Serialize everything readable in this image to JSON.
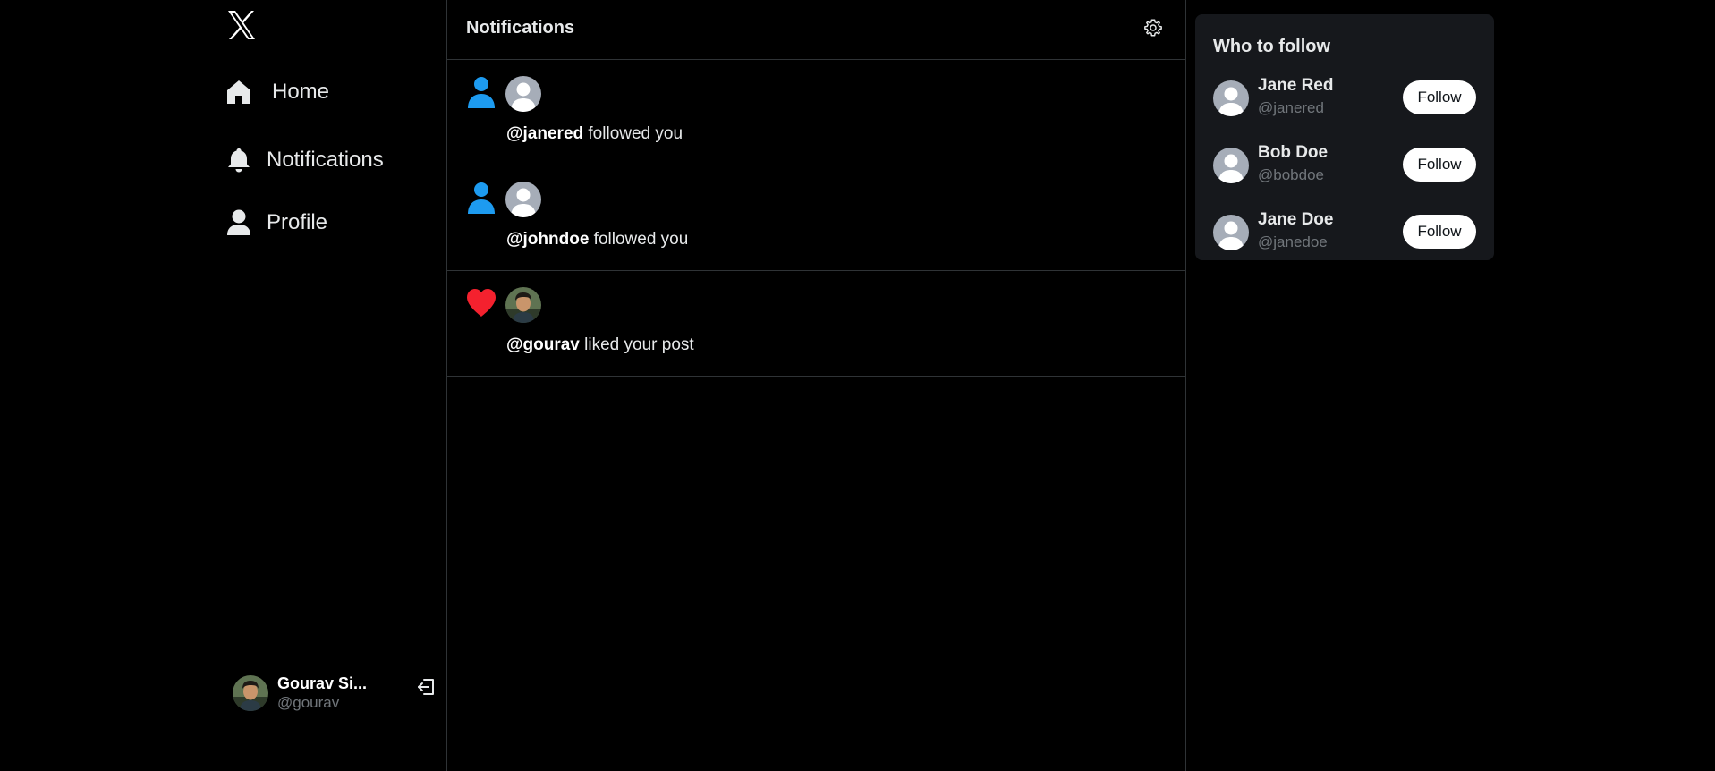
{
  "app": {
    "logo_icon": "x-logo-icon"
  },
  "sidebar": {
    "nav": [
      {
        "label": "Home",
        "icon": "home-icon"
      },
      {
        "label": "Notifications",
        "icon": "bell-icon"
      },
      {
        "label": "Profile",
        "icon": "person-icon"
      }
    ],
    "account": {
      "name": "Gourav Si...",
      "handle": "@gourav",
      "logout_icon": "logout-icon"
    }
  },
  "main": {
    "title": "Notifications",
    "settings_icon": "gear-icon",
    "notifications": [
      {
        "type_icon": "person-icon",
        "handle": "@janered",
        "text": " followed you"
      },
      {
        "type_icon": "person-icon",
        "handle": "@johndoe",
        "text": " followed you"
      },
      {
        "type_icon": "heart-icon",
        "handle": "@gourav",
        "text": " liked your post"
      }
    ]
  },
  "right": {
    "title": "Who to follow",
    "items": [
      {
        "name": "Jane Red",
        "handle": "@janered",
        "button": "Follow"
      },
      {
        "name": "Bob Doe",
        "handle": "@bobdoe",
        "button": "Follow"
      },
      {
        "name": "Jane Doe",
        "handle": "@janedoe",
        "button": "Follow"
      }
    ]
  },
  "colors": {
    "background": "#000000",
    "accent_blue": "#1d9bf0",
    "like_red": "#f4212e",
    "border": "#2f3336",
    "card": "#16181c",
    "muted_text": "#71767b"
  }
}
